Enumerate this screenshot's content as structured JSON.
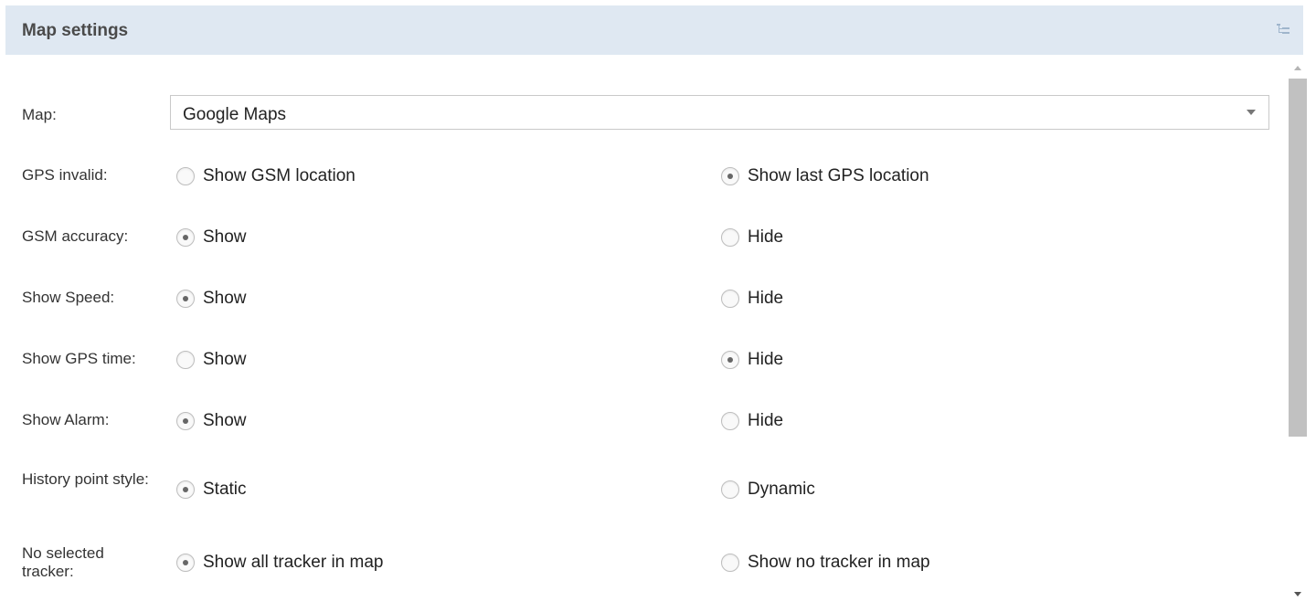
{
  "header": {
    "title": "Map settings",
    "collapse_icon": "collapse-tree-icon"
  },
  "map": {
    "label": "Map:",
    "value": "Google Maps"
  },
  "rows": [
    {
      "label": "GPS invalid:",
      "options": [
        "Show GSM location",
        "Show last GPS location"
      ],
      "selected": 1
    },
    {
      "label": "GSM accuracy:",
      "options": [
        "Show",
        "Hide"
      ],
      "selected": 0
    },
    {
      "label": "Show Speed:",
      "options": [
        "Show",
        "Hide"
      ],
      "selected": 0
    },
    {
      "label": "Show GPS time:",
      "options": [
        "Show",
        "Hide"
      ],
      "selected": 1
    },
    {
      "label": "Show Alarm:",
      "options": [
        "Show",
        "Hide"
      ],
      "selected": 0
    },
    {
      "label": "History point style:",
      "options": [
        "Static",
        "Dynamic"
      ],
      "selected": 0
    },
    {
      "label": "No selected tracker:",
      "options": [
        "Show all tracker in map",
        "Show no tracker in map"
      ],
      "selected": 0
    }
  ]
}
